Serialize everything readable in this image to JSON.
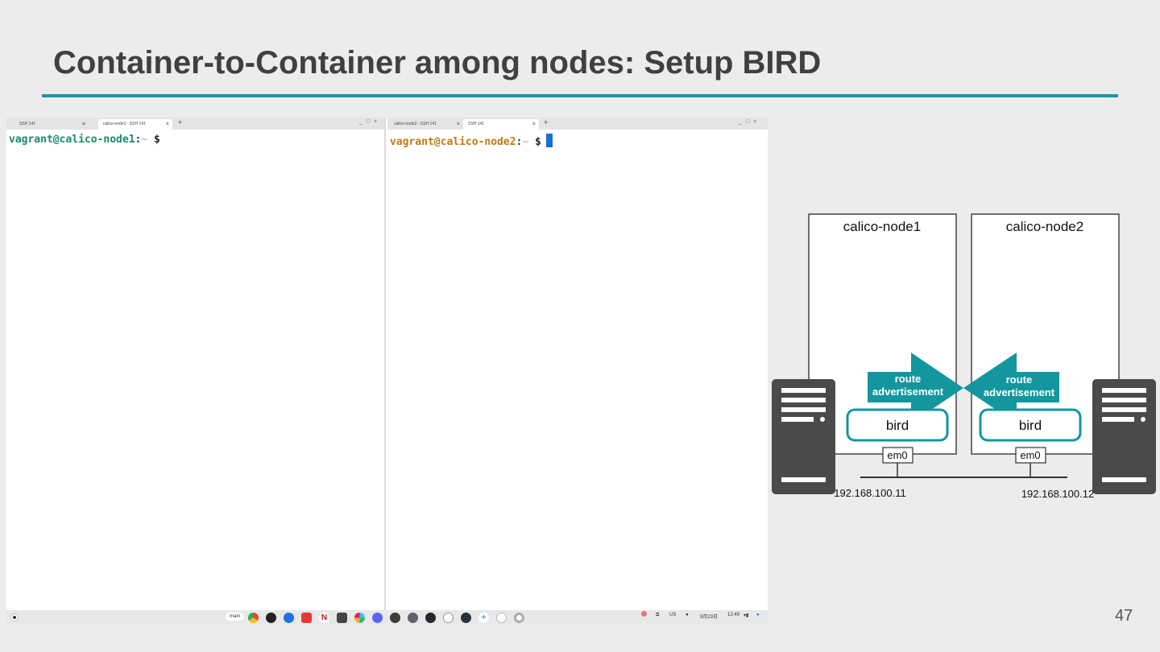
{
  "slide": {
    "title": "Container-to-Container among nodes: Setup BIRD",
    "page_number": "47",
    "accent_color": "#1e95a8"
  },
  "terminal_left": {
    "tabs": [
      {
        "label": "SSH 141",
        "active": false
      },
      {
        "label": "calico-node1 - SSH 141",
        "active": true
      }
    ],
    "prompt_user": "vagrant@calico-node1",
    "prompt_colon": ":",
    "prompt_path": "~",
    "prompt_symbol": "$"
  },
  "terminal_right": {
    "tabs": [
      {
        "label": "calico-node2 - SSH 141",
        "active": false
      },
      {
        "label": "SSH 141",
        "active": true
      }
    ],
    "prompt_user": "vagrant@calico-node2",
    "prompt_colon": ":",
    "prompt_path": "~",
    "prompt_symbol": "$"
  },
  "shelf": {
    "desk_label": "main",
    "apps": [
      "chrome-icon",
      "github-icon",
      "files-icon",
      "youtube-icon",
      "netflix-icon",
      "bitwarden-icon",
      "slack-icon",
      "discord-icon",
      "terminal-icon",
      "code-icon",
      "github-desktop-icon",
      "notes-icon",
      "hexagon-app-icon",
      "plus-app-icon",
      "mountain-app-icon",
      "dot-app-icon"
    ],
    "ime": "US",
    "date": "9月23日",
    "time": "12:49"
  },
  "diagram": {
    "node1_label": "calico-node1",
    "node2_label": "calico-node2",
    "route_left_line1": "route",
    "route_left_line2": "advertisement",
    "route_right_line1": "route",
    "route_right_line2": "advertisement",
    "bird_left": "bird",
    "bird_right": "bird",
    "em0_left": "em0",
    "em0_right": "em0",
    "ip_left": "192.168.100.11",
    "ip_right": "192.168.100.12",
    "accent_color": "#14969f",
    "server_color": "#4a4a4a"
  }
}
